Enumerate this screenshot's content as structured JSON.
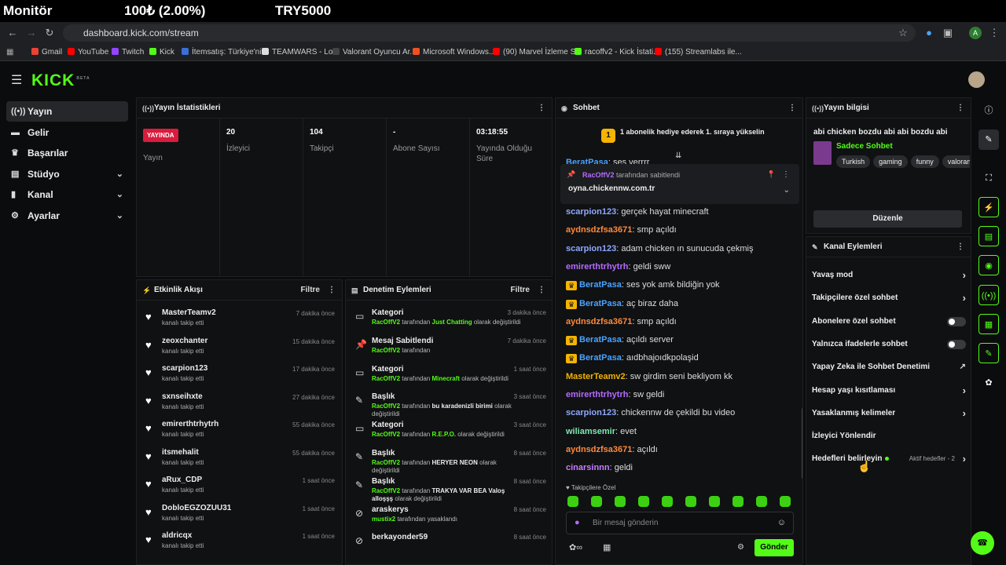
{
  "overlay": {
    "monitor": "Monitör",
    "goal": "100₺ (2.00%)",
    "target": "TRY5000"
  },
  "browser": {
    "url": "dashboard.kick.com/stream",
    "profile": "A",
    "bookmarks": [
      "Gmail",
      "YouTube",
      "Twitch",
      "Kick",
      "İtemsatış: Türkiye'ni...",
      "TEAMWARS - Lobi",
      "Valorant Oyuncu Ar...",
      "Microsoft Windows...",
      "(90) Marvel İzleme S...",
      "racoffv2 - Kick İstati...",
      "(155) Streamlabs ile..."
    ]
  },
  "app": {
    "logo": "KICK",
    "beta": "BETA"
  },
  "sidebar": [
    {
      "label": "Yayın",
      "icon": "broadcast-icon"
    },
    {
      "label": "Gelir",
      "icon": "money-icon"
    },
    {
      "label": "Başarılar",
      "icon": "trophy-icon"
    },
    {
      "label": "Stüdyo",
      "icon": "studio-icon"
    },
    {
      "label": "Kanal",
      "icon": "channel-icon"
    },
    {
      "label": "Ayarlar",
      "icon": "gear-icon"
    }
  ],
  "stats": {
    "title": "Yayın İstatistikleri",
    "live_badge": "YAYINDA",
    "cells": [
      {
        "value": "",
        "label": "Yayın"
      },
      {
        "value": "20",
        "label": "İzleyici"
      },
      {
        "value": "104",
        "label": "Takipçi"
      },
      {
        "value": "-",
        "label": "Abone Sayısı"
      },
      {
        "value": "03:18:55",
        "label": "Yayında Olduğu Süre"
      }
    ]
  },
  "activity": {
    "title": "Etkinlik Akışı",
    "filter": "Filtre",
    "items": [
      {
        "name": "MasterTeamv2",
        "sub": "kanalı takip etti",
        "time": "7 dakika önce"
      },
      {
        "name": "zeoxchanter",
        "sub": "kanalı takip etti",
        "time": "15 dakika önce"
      },
      {
        "name": "scarpion123",
        "sub": "kanalı takip etti",
        "time": "17 dakika önce"
      },
      {
        "name": "sxnseihxte",
        "sub": "kanalı takip etti",
        "time": "27 dakika önce"
      },
      {
        "name": "emirerthtrhytrh",
        "sub": "kanalı takip etti",
        "time": "55 dakika önce"
      },
      {
        "name": "itsmehalit",
        "sub": "kanalı takip etti",
        "time": "55 dakika önce"
      },
      {
        "name": "aRux_CDP",
        "sub": "kanalı takip etti",
        "time": "1 saat önce"
      },
      {
        "name": "DobloEGZOZUU31",
        "sub": "kanalı takip etti",
        "time": "1 saat önce"
      },
      {
        "name": "aldricqx",
        "sub": "kanalı takip etti",
        "time": "1 saat önce"
      }
    ]
  },
  "moderation": {
    "title": "Denetim Eylemleri",
    "filter": "Filtre",
    "items": [
      {
        "title": "Kategori",
        "user": "RacOffV2",
        "mid": " tarafından ",
        "value": "Just Chatting",
        "end": " olarak değiştirildi",
        "time": "3 dakika önce",
        "icon": "category-icon"
      },
      {
        "title": "Mesaj Sabitlendi",
        "user": "RacOffV2",
        "mid": " tarafından",
        "value": "",
        "end": "",
        "time": "7 dakika önce",
        "icon": "pin-icon"
      },
      {
        "title": "Kategori",
        "user": "RacOffV2",
        "mid": " tarafından ",
        "value": "Minecraft",
        "end": " olarak değiştirildi",
        "time": "1 saat önce",
        "icon": "category-icon"
      },
      {
        "title": "Başlık",
        "user": "RacOffV2",
        "mid": " tarafından ",
        "value": "bu karadenizli birimi",
        "end": " olarak değiştirildi",
        "time": "3 saat önce",
        "icon": "title-icon"
      },
      {
        "title": "Kategori",
        "user": "RacOffV2",
        "mid": " tarafından ",
        "value": "R.E.P.O.",
        "end": " olarak değiştirildi",
        "time": "3 saat önce",
        "icon": "category-icon"
      },
      {
        "title": "Başlık",
        "user": "RacOffV2",
        "mid": " tarafından ",
        "value": "HERYER NEON",
        "end": " olarak değiştirildi",
        "time": "8 saat önce",
        "icon": "title-icon"
      },
      {
        "title": "Başlık",
        "user": "RacOffV2",
        "mid": " tarafından ",
        "value": "TRAKYA VAR BEA Valoş alloşşş",
        "end": " olarak değiştirildi",
        "time": "8 saat önce",
        "icon": "title-icon"
      },
      {
        "title": "araskerys",
        "user": "mustix2",
        "mid": " tarafından yasaklandı",
        "value": "",
        "end": "",
        "time": "8 saat önce",
        "icon": "ban-icon"
      },
      {
        "title": "berkayonder59",
        "user": "",
        "mid": "",
        "value": "",
        "end": "",
        "time": "8 saat önce",
        "icon": "ban-icon"
      }
    ]
  },
  "chat": {
    "title": "Sohbet",
    "gift_banner": "1 abonelik hediye ederek 1. sıraya yükselin",
    "gift_rank": "1",
    "partial": "ses verrrr",
    "partial_user": "BeratPasa",
    "pinned": {
      "user": "RacOffV2",
      "by": "tarafından sabitlendi",
      "text": "oyna.chickennw.com.tr"
    },
    "messages": [
      {
        "user": "scarpion123",
        "text": "gerçek hayat minecraft",
        "color": "#8fa8ff",
        "crown": false
      },
      {
        "user": "aydnsdzfsa3671",
        "text": "smp açıldı",
        "color": "#ff8a3d",
        "crown": false
      },
      {
        "user": "scarpion123",
        "text": "adam chicken ın sunucuda çekmiş",
        "color": "#8fa8ff",
        "crown": false
      },
      {
        "user": "emirerthtrhytrh",
        "text": "geldi sww",
        "color": "#b46bff",
        "crown": false
      },
      {
        "user": "BeratPasa",
        "text": "ses yok amk bildiğin yok",
        "color": "#4aa3ff",
        "crown": true
      },
      {
        "user": "BeratPasa",
        "text": "aç biraz daha",
        "color": "#4aa3ff",
        "crown": true
      },
      {
        "user": "aydnsdzfsa3671",
        "text": "smp açıldı",
        "color": "#ff8a3d",
        "crown": false
      },
      {
        "user": "BeratPasa",
        "text": "açıldı server",
        "color": "#4aa3ff",
        "crown": true
      },
      {
        "user": "BeratPasa",
        "text": "aıdbhajoıdkpolaşid",
        "color": "#4aa3ff",
        "crown": true
      },
      {
        "user": "MasterTeamv2",
        "text": "sw girdim seni bekliyom kk",
        "color": "#f0b400",
        "crown": false
      },
      {
        "user": "emirerthtrhytrh",
        "text": "sw geldi",
        "color": "#b46bff",
        "crown": false
      },
      {
        "user": "scarpion123",
        "text": "chickennw de çekildi bu video",
        "color": "#8fa8ff",
        "crown": false
      },
      {
        "user": "wiliamsemir",
        "text": "evet",
        "color": "#7ee8b0",
        "crown": false
      },
      {
        "user": "aydnsdzfsa3671",
        "text": "açıldı",
        "color": "#ff8a3d",
        "crown": false
      },
      {
        "user": "cinarsinnn",
        "text": "geldi",
        "color": "#c77dff",
        "crown": false
      }
    ],
    "followers_only": "Takipçilere Özel",
    "placeholder": "Bir mesaj gönderin",
    "send": "Gönder"
  },
  "info": {
    "title": "Yayın bilgisi",
    "stream_title": "abi chicken bozdu abi abi bozdu abi",
    "category": "Sadece Sohbet",
    "tags": [
      "Turkish",
      "gaming",
      "funny",
      "valorant"
    ],
    "edit": "Düzenle"
  },
  "actions": {
    "title": "Kanal Eylemleri",
    "items": [
      {
        "label": "Yavaş mod",
        "control": "chevron"
      },
      {
        "label": "Takipçilere özel sohbet",
        "control": "chevron"
      },
      {
        "label": "Abonelere özel sohbet",
        "control": "toggle"
      },
      {
        "label": "Yalnızca ifadelerle sohbet",
        "control": "toggle"
      },
      {
        "label": "Yapay Zeka ile Sohbet Denetimi",
        "control": "external"
      },
      {
        "label": "Hesap yaşı kısıtlaması",
        "control": "chevron"
      },
      {
        "label": "Yasaklanmış kelimeler",
        "control": "chevron"
      },
      {
        "label": "İzleyici Yönlendir",
        "control": "none"
      },
      {
        "label": "Hedefleri belirleyin",
        "control": "chevron",
        "extra": "Aktif hedefler - 2"
      }
    ]
  },
  "colors": {
    "accent": "#53fc18",
    "live": "#d91c3d",
    "bg": "#0b0c0d",
    "panel": "#101113"
  }
}
